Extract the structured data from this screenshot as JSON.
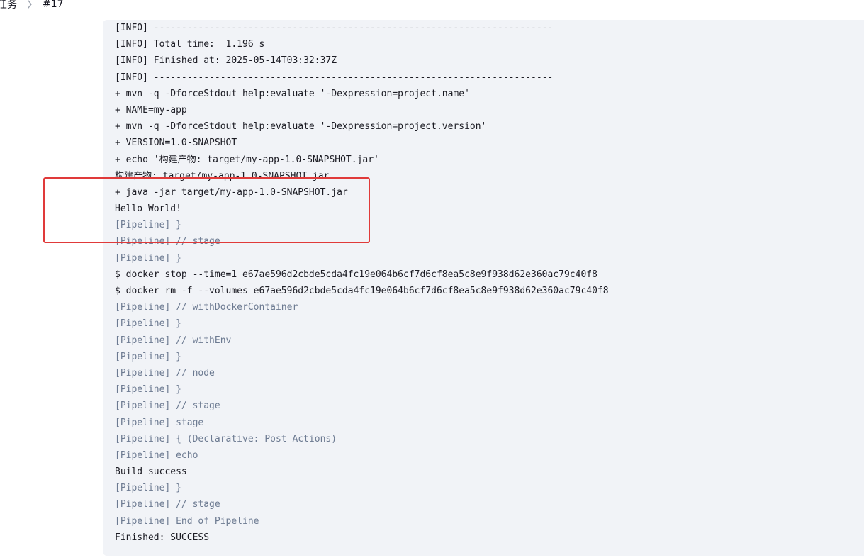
{
  "breadcrumb": {
    "parent": "任务",
    "current": "#17"
  },
  "console": {
    "lines": [
      {
        "text": "[INFO] ------------------------------------------------------------------------",
        "kind": "plain"
      },
      {
        "text": "[INFO] Total time:  1.196 s",
        "kind": "plain"
      },
      {
        "text": "[INFO] Finished at: 2025-05-14T03:32:37Z",
        "kind": "plain"
      },
      {
        "text": "[INFO] ------------------------------------------------------------------------",
        "kind": "plain"
      },
      {
        "text": "+ mvn -q -DforceStdout help:evaluate '-Dexpression=project.name'",
        "kind": "plain"
      },
      {
        "text": "+ NAME=my-app",
        "kind": "plain"
      },
      {
        "text": "+ mvn -q -DforceStdout help:evaluate '-Dexpression=project.version'",
        "kind": "plain"
      },
      {
        "text": "+ VERSION=1.0-SNAPSHOT",
        "kind": "plain"
      },
      {
        "text": "+ echo '构建产物: target/my-app-1.0-SNAPSHOT.jar'",
        "kind": "plain"
      },
      {
        "text": "构建产物: target/my-app-1.0-SNAPSHOT.jar",
        "kind": "plain"
      },
      {
        "text": "+ java -jar target/my-app-1.0-SNAPSHOT.jar",
        "kind": "plain"
      },
      {
        "text": "Hello World!",
        "kind": "plain"
      },
      {
        "text": "[Pipeline] }",
        "kind": "pipeline"
      },
      {
        "text": "[Pipeline] // stage",
        "kind": "pipeline"
      },
      {
        "text": "[Pipeline] }",
        "kind": "pipeline"
      },
      {
        "text": "$ docker stop --time=1 e67ae596d2cbde5cda4fc19e064b6cf7d6cf8ea5c8e9f938d62e360ac79c40f8",
        "kind": "plain"
      },
      {
        "text": "$ docker rm -f --volumes e67ae596d2cbde5cda4fc19e064b6cf7d6cf8ea5c8e9f938d62e360ac79c40f8",
        "kind": "plain"
      },
      {
        "text": "[Pipeline] // withDockerContainer",
        "kind": "pipeline"
      },
      {
        "text": "[Pipeline] }",
        "kind": "pipeline"
      },
      {
        "text": "[Pipeline] // withEnv",
        "kind": "pipeline"
      },
      {
        "text": "[Pipeline] }",
        "kind": "pipeline"
      },
      {
        "text": "[Pipeline] // node",
        "kind": "pipeline"
      },
      {
        "text": "[Pipeline] }",
        "kind": "pipeline"
      },
      {
        "text": "[Pipeline] // stage",
        "kind": "pipeline"
      },
      {
        "text": "[Pipeline] stage",
        "kind": "pipeline"
      },
      {
        "text": "[Pipeline] { (Declarative: Post Actions)",
        "kind": "pipeline"
      },
      {
        "text": "[Pipeline] echo",
        "kind": "pipeline"
      },
      {
        "text": "Build success",
        "kind": "plain"
      },
      {
        "text": "[Pipeline] }",
        "kind": "pipeline"
      },
      {
        "text": "[Pipeline] // stage",
        "kind": "pipeline"
      },
      {
        "text": "[Pipeline] End of Pipeline",
        "kind": "pipeline"
      },
      {
        "text": "Finished: SUCCESS",
        "kind": "plain"
      }
    ]
  },
  "colors": {
    "console_background": "#f1f3f7",
    "pipeline_text": "#6c7a91",
    "plain_text": "#1b1b23",
    "highlight_border": "#e03a3a"
  }
}
